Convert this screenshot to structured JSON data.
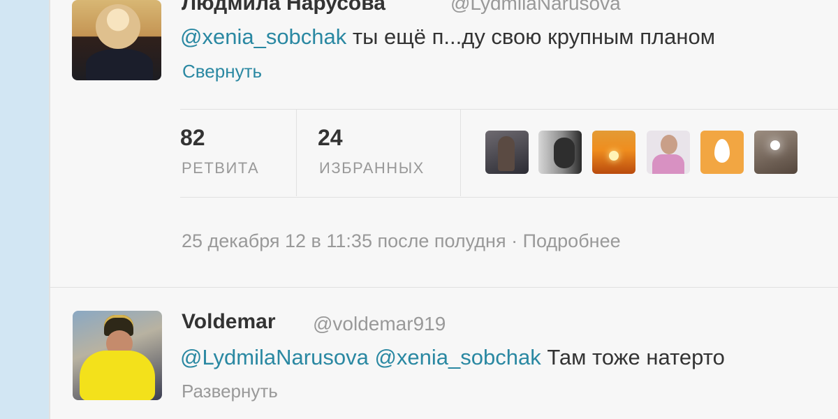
{
  "tweet": {
    "author_name": "Людмила Нарусова",
    "author_handle": "@LydmilaNarusova",
    "mention": "@xenia_sobchak",
    "text": " ты ещё п...ду свою крупным планом",
    "collapse": "Свернуть",
    "retweets": "82",
    "retweets_label": "РЕТВИТА",
    "favorites": "24",
    "favorites_label": "ИЗБРАННЫХ",
    "timestamp": "25 декабря 12 в 11:35 после полудня",
    "separator": " · ",
    "details": "Подробнее"
  },
  "reply": {
    "author_name": "Voldemar",
    "author_handle": "@voldemar919",
    "mention1": "@LydmilaNarusova",
    "mention2": "@xenia_sobchak",
    "text": " Там тоже натерто",
    "expand": "Развернуть"
  }
}
